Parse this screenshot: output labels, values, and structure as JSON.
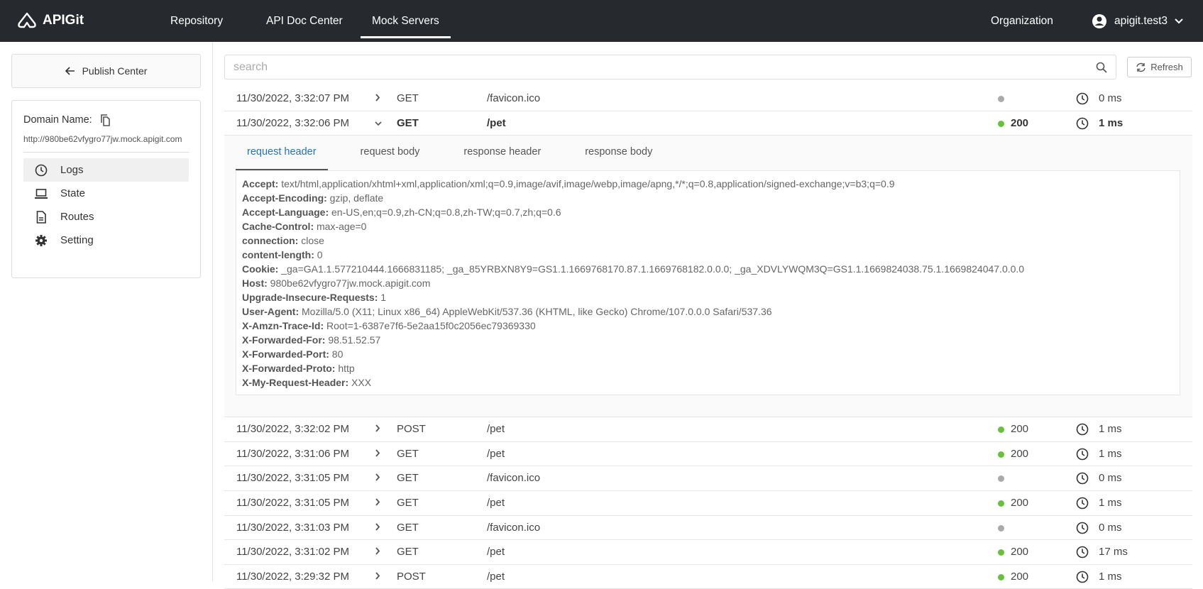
{
  "topbar": {
    "logo": "APIGit",
    "nav": [
      "Repository",
      "API Doc Center",
      "Mock Servers"
    ],
    "active": "Mock Servers",
    "organization": "Organization",
    "user": "apigit.test3"
  },
  "sidebar": {
    "publish_center": "Publish Center",
    "domain_label": "Domain Name:",
    "domain_url": "http://980be62vfygro77jw.mock.apigit.com",
    "menu": [
      {
        "label": "Logs",
        "icon": "clock-icon",
        "active": true
      },
      {
        "label": "State",
        "icon": "laptop-icon"
      },
      {
        "label": "Routes",
        "icon": "document-icon"
      },
      {
        "label": "Setting",
        "icon": "gear-icon"
      }
    ]
  },
  "search": {
    "placeholder": "search",
    "value": ""
  },
  "refresh_label": "Refresh",
  "colors": {
    "success": "#67c23a",
    "neutral": "#aaaaaa",
    "tab_active": "#1e73c8"
  },
  "logs": [
    {
      "time": "11/30/2022, 3:32:07 PM",
      "method": "GET",
      "path": "/favicon.ico",
      "status": "",
      "duration": "0 ms"
    },
    {
      "time": "11/30/2022, 3:32:06 PM",
      "method": "GET",
      "path": "/pet",
      "status": "200",
      "duration": "1 ms",
      "expanded": true
    },
    {
      "time": "11/30/2022, 3:32:02 PM",
      "method": "POST",
      "path": "/pet",
      "status": "200",
      "duration": "1 ms"
    },
    {
      "time": "11/30/2022, 3:31:06 PM",
      "method": "GET",
      "path": "/pet",
      "status": "200",
      "duration": "1 ms"
    },
    {
      "time": "11/30/2022, 3:31:05 PM",
      "method": "GET",
      "path": "/favicon.ico",
      "status": "",
      "duration": "0 ms"
    },
    {
      "time": "11/30/2022, 3:31:05 PM",
      "method": "GET",
      "path": "/pet",
      "status": "200",
      "duration": "1 ms"
    },
    {
      "time": "11/30/2022, 3:31:03 PM",
      "method": "GET",
      "path": "/favicon.ico",
      "status": "",
      "duration": "0 ms"
    },
    {
      "time": "11/30/2022, 3:31:02 PM",
      "method": "GET",
      "path": "/pet",
      "status": "200",
      "duration": "17 ms"
    },
    {
      "time": "11/30/2022, 3:29:32 PM",
      "method": "POST",
      "path": "/pet",
      "status": "200",
      "duration": "1 ms"
    }
  ],
  "detail": {
    "tabs": [
      "request header",
      "request body",
      "response header",
      "response body"
    ],
    "active_tab": "request header",
    "headers": [
      [
        "Accept:",
        "text/html,application/xhtml+xml,application/xml;q=0.9,image/avif,image/webp,image/apng,*/*;q=0.8,application/signed-exchange;v=b3;q=0.9"
      ],
      [
        "Accept-Encoding:",
        "gzip, deflate"
      ],
      [
        "Accept-Language:",
        "en-US,en;q=0.9,zh-CN;q=0.8,zh-TW;q=0.7,zh;q=0.6"
      ],
      [
        "Cache-Control:",
        "max-age=0"
      ],
      [
        "connection:",
        "close"
      ],
      [
        "content-length:",
        "0"
      ],
      [
        "Cookie:",
        "_ga=GA1.1.577210444.1666831185; _ga_85YRBXN8Y9=GS1.1.1669768170.87.1.1669768182.0.0.0; _ga_XDVLYWQM3Q=GS1.1.1669824038.75.1.1669824047.0.0.0"
      ],
      [
        "Host:",
        "980be62vfygro77jw.mock.apigit.com"
      ],
      [
        "Upgrade-Insecure-Requests:",
        "1"
      ],
      [
        "User-Agent:",
        "Mozilla/5.0 (X11; Linux x86_64) AppleWebKit/537.36 (KHTML, like Gecko) Chrome/107.0.0.0 Safari/537.36"
      ],
      [
        "X-Amzn-Trace-Id:",
        "Root=1-6387e7f6-5e2aa15f0c2056ec79369330"
      ],
      [
        "X-Forwarded-For:",
        "98.51.52.57"
      ],
      [
        "X-Forwarded-Port:",
        "80"
      ],
      [
        "X-Forwarded-Proto:",
        "http"
      ],
      [
        "X-My-Request-Header:",
        "XXX"
      ]
    ]
  }
}
